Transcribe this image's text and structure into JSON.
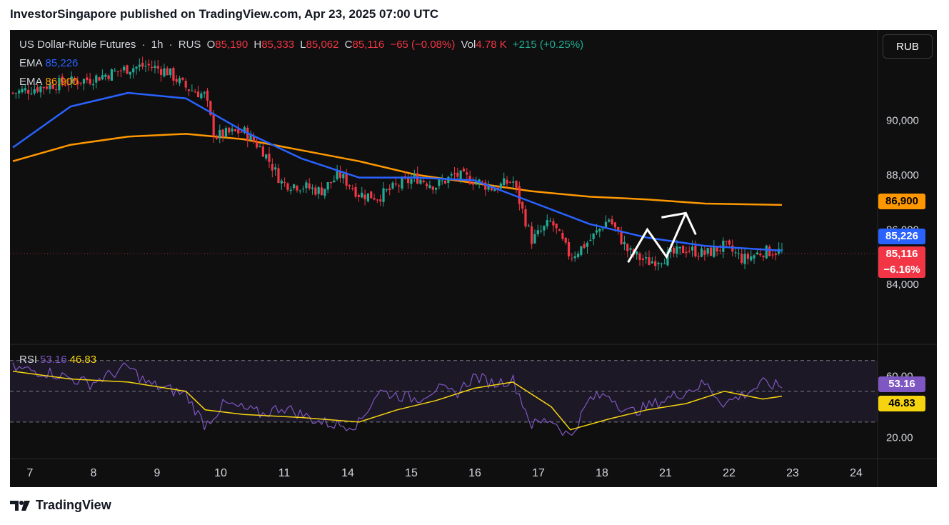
{
  "header": {
    "text": "InvestorSingapore published on TradingView.com, Apr 23, 2025 07:00 UTC"
  },
  "legend": {
    "title": "US Dollar-Ruble Futures",
    "interval": "1h",
    "exchange": "RUS",
    "o_label": "O",
    "o_value": "85,190",
    "h_label": "H",
    "h_value": "85,333",
    "l_label": "L",
    "l_value": "85,062",
    "c_label": "C",
    "c_value": "85,116",
    "change": "−65 (−0.08%)",
    "vol_label": "Vol",
    "vol_value": "4.78 K",
    "vol_change": "+215 (+0.25%)",
    "ema1_label": "EMA",
    "ema1_value": "85,226",
    "ema2_label": "EMA",
    "ema2_value": "86,900",
    "rsi_label": "RSI",
    "rsi_value": "53.16",
    "rsi_ma_value": "46.83"
  },
  "currency_button": "RUB",
  "price_tags": {
    "ema_slow": "86,900",
    "ema_fast": "85,226",
    "last": "85,116",
    "last_pct": "−6.16%",
    "rsi": "53.16",
    "rsi_ma": "46.83"
  },
  "footer": {
    "brand": "TradingView"
  },
  "colors": {
    "up": "#22ab94",
    "down": "#f23645",
    "ema_fast": "#2962ff",
    "ema_slow": "#ff9800",
    "rsi": "#7e57c2",
    "rsi_ma": "#f5d40f"
  },
  "chart_data": {
    "type": "candlestick",
    "title": "US Dollar-Ruble Futures",
    "interval": "1h",
    "y_ticks": [
      "90,000",
      "88,000",
      "86,000",
      "84,000"
    ],
    "y_tick_values": [
      90000,
      88000,
      86000,
      84000
    ],
    "ylim": [
      81800,
      93300
    ],
    "x_ticks": [
      "7",
      "8",
      "9",
      "10",
      "11",
      "14",
      "15",
      "16",
      "17",
      "18",
      "21",
      "22",
      "23",
      "24"
    ],
    "close_path": [
      [
        0,
        91000
      ],
      [
        2,
        91300
      ],
      [
        4,
        91500
      ],
      [
        6,
        91900
      ],
      [
        7,
        92000
      ],
      [
        8,
        91800
      ],
      [
        9,
        91200
      ],
      [
        10,
        90900
      ],
      [
        10.5,
        89400
      ],
      [
        11,
        89500
      ],
      [
        12,
        89600
      ],
      [
        13,
        88900
      ],
      [
        14,
        87700
      ],
      [
        15,
        87600
      ],
      [
        16,
        87400
      ],
      [
        17,
        88000
      ],
      [
        18,
        87300
      ],
      [
        19,
        87200
      ],
      [
        20,
        87600
      ],
      [
        21,
        87900
      ],
      [
        22,
        87600
      ],
      [
        23,
        88000
      ],
      [
        24,
        87800
      ],
      [
        25,
        87500
      ],
      [
        26,
        87800
      ],
      [
        27,
        85600
      ],
      [
        28,
        86300
      ],
      [
        29,
        85000
      ],
      [
        30,
        85600
      ],
      [
        31,
        86400
      ],
      [
        32,
        85200
      ],
      [
        33,
        84800
      ],
      [
        34,
        85000
      ],
      [
        35,
        85300
      ],
      [
        36,
        85100
      ],
      [
        37,
        85400
      ],
      [
        38,
        84900
      ],
      [
        39,
        85200
      ],
      [
        40,
        85200
      ]
    ],
    "ema_fast": [
      [
        0,
        89000
      ],
      [
        3,
        90500
      ],
      [
        6,
        91000
      ],
      [
        9,
        90800
      ],
      [
        12,
        89600
      ],
      [
        15,
        88600
      ],
      [
        18,
        87900
      ],
      [
        21,
        87900
      ],
      [
        24,
        87800
      ],
      [
        27,
        87000
      ],
      [
        30,
        86200
      ],
      [
        33,
        85700
      ],
      [
        36,
        85400
      ],
      [
        40,
        85226
      ]
    ],
    "ema_slow": [
      [
        0,
        88500
      ],
      [
        3,
        89100
      ],
      [
        6,
        89400
      ],
      [
        9,
        89500
      ],
      [
        12,
        89300
      ],
      [
        15,
        88900
      ],
      [
        18,
        88500
      ],
      [
        21,
        88000
      ],
      [
        24,
        87700
      ],
      [
        27,
        87400
      ],
      [
        30,
        87200
      ],
      [
        33,
        87100
      ],
      [
        36,
        86950
      ],
      [
        40,
        86900
      ]
    ],
    "rsi": {
      "levels": [
        70,
        50,
        30
      ],
      "y_ticks": [
        "60.00",
        "20.00"
      ],
      "y_tick_values": [
        60,
        20
      ],
      "ylim": [
        10,
        75
      ],
      "rsi_path": [
        [
          0,
          65
        ],
        [
          2,
          62
        ],
        [
          4,
          55
        ],
        [
          6,
          66
        ],
        [
          7,
          55
        ],
        [
          9,
          48
        ],
        [
          10,
          28
        ],
        [
          11,
          42
        ],
        [
          13,
          35
        ],
        [
          14,
          40
        ],
        [
          15,
          35
        ],
        [
          16,
          30
        ],
        [
          17,
          28
        ],
        [
          18,
          29
        ],
        [
          19,
          50
        ],
        [
          21,
          45
        ],
        [
          22,
          52
        ],
        [
          23,
          48
        ],
        [
          24,
          60
        ],
        [
          25,
          55
        ],
        [
          26,
          58
        ],
        [
          27,
          28
        ],
        [
          28,
          32
        ],
        [
          29,
          20
        ],
        [
          30,
          45
        ],
        [
          31,
          48
        ],
        [
          32,
          36
        ],
        [
          33,
          40
        ],
        [
          34,
          45
        ],
        [
          35,
          50
        ],
        [
          36,
          55
        ],
        [
          37,
          42
        ],
        [
          38,
          48
        ],
        [
          39,
          55
        ],
        [
          40,
          53.16
        ]
      ],
      "ma_path": [
        [
          0,
          63
        ],
        [
          3,
          58
        ],
        [
          6,
          56
        ],
        [
          9,
          50
        ],
        [
          10,
          38
        ],
        [
          12,
          35
        ],
        [
          15,
          33
        ],
        [
          18,
          30
        ],
        [
          20,
          38
        ],
        [
          22,
          44
        ],
        [
          24,
          52
        ],
        [
          26,
          56
        ],
        [
          28,
          40
        ],
        [
          29,
          25
        ],
        [
          31,
          32
        ],
        [
          33,
          38
        ],
        [
          35,
          42
        ],
        [
          37,
          50
        ],
        [
          39,
          45
        ],
        [
          40,
          46.83
        ]
      ]
    },
    "annotation": "white zig-zag arrow pointing up-right near 85,000-86,500"
  }
}
